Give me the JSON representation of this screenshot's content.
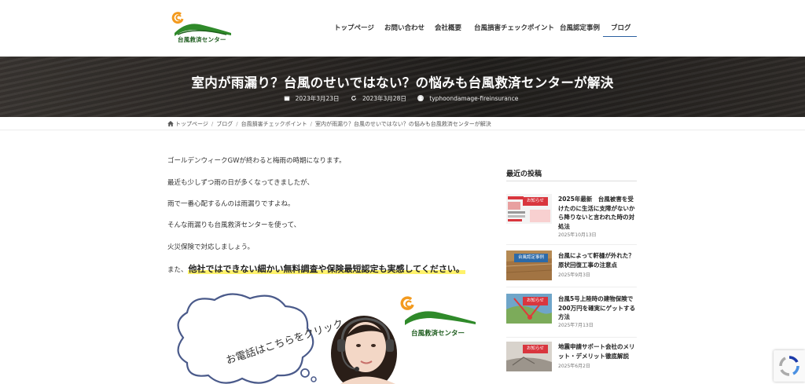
{
  "site": {
    "logo_text": "台風救済センター"
  },
  "nav": {
    "items": [
      {
        "label": "トップページ"
      },
      {
        "label": "お問い合わせ"
      },
      {
        "label": "会社概要"
      },
      {
        "label": "台風損害チェックポイント"
      },
      {
        "label": "台風認定事例"
      },
      {
        "label": "ブログ"
      }
    ],
    "active": "ブログ"
  },
  "hero": {
    "title": "室内が雨漏り？台風のせいではない？の悩みも台風救済センターが解決",
    "published": "2023年3月23日",
    "updated": "2023年3月28日",
    "author": "typhoondamage-fireinsurance"
  },
  "breadcrumb": {
    "items": [
      "トップページ",
      "ブログ",
      "台風損害チェックポイント"
    ],
    "current": "室内が雨漏り？台風のせいではない？の悩みも台風救済センターが解決"
  },
  "article": {
    "paragraphs": [
      "ゴールデンウィークGWが終わると梅雨の時期になります。",
      "最近も少しずつ雨の日が多くなってきましたが、",
      "雨で一番心配するんのは雨漏りですよね。",
      "そんな雨漏りも台風救済センターを使って、",
      "火災保険で対応しましょう。"
    ],
    "lead_prefix": "また、",
    "lead_highlight": "他社ではできない細かい無料調査や保険最短認定も実感してください。",
    "banner": {
      "bubble_text": "お電話はこちらをクリック",
      "logo_text": "台風救済センター"
    }
  },
  "sidebar": {
    "title": "最近の投稿",
    "posts": [
      {
        "tag": "お知らせ",
        "title": "2025年最新　台風被害を受けたのに生活に支障がないから降りないと言われた時の対処法",
        "date": "2025年10月13日",
        "tag_color": "#d9363e"
      },
      {
        "tag": "台風認定事例",
        "title": "台風によって軒樋が外れた？原状回復工事の注意点",
        "date": "2025年9月3日",
        "tag_color": "#2c6aa8"
      },
      {
        "tag": "お知らせ",
        "title": "台風5号上陸時の建物保険で200万円を確実にゲットする方法",
        "date": "2025年7月13日",
        "tag_color": "#d9363e"
      },
      {
        "tag": "お知らせ",
        "title": "地震申請サポート会社のメリット・デメリット徹底解説",
        "date": "2025年6月2日",
        "tag_color": "#d9363e"
      }
    ]
  },
  "colors": {
    "accent": "#2b5fa0",
    "highlight": "#fff26b",
    "tag_red": "#d9363e",
    "tag_blue": "#2c6aa8"
  }
}
